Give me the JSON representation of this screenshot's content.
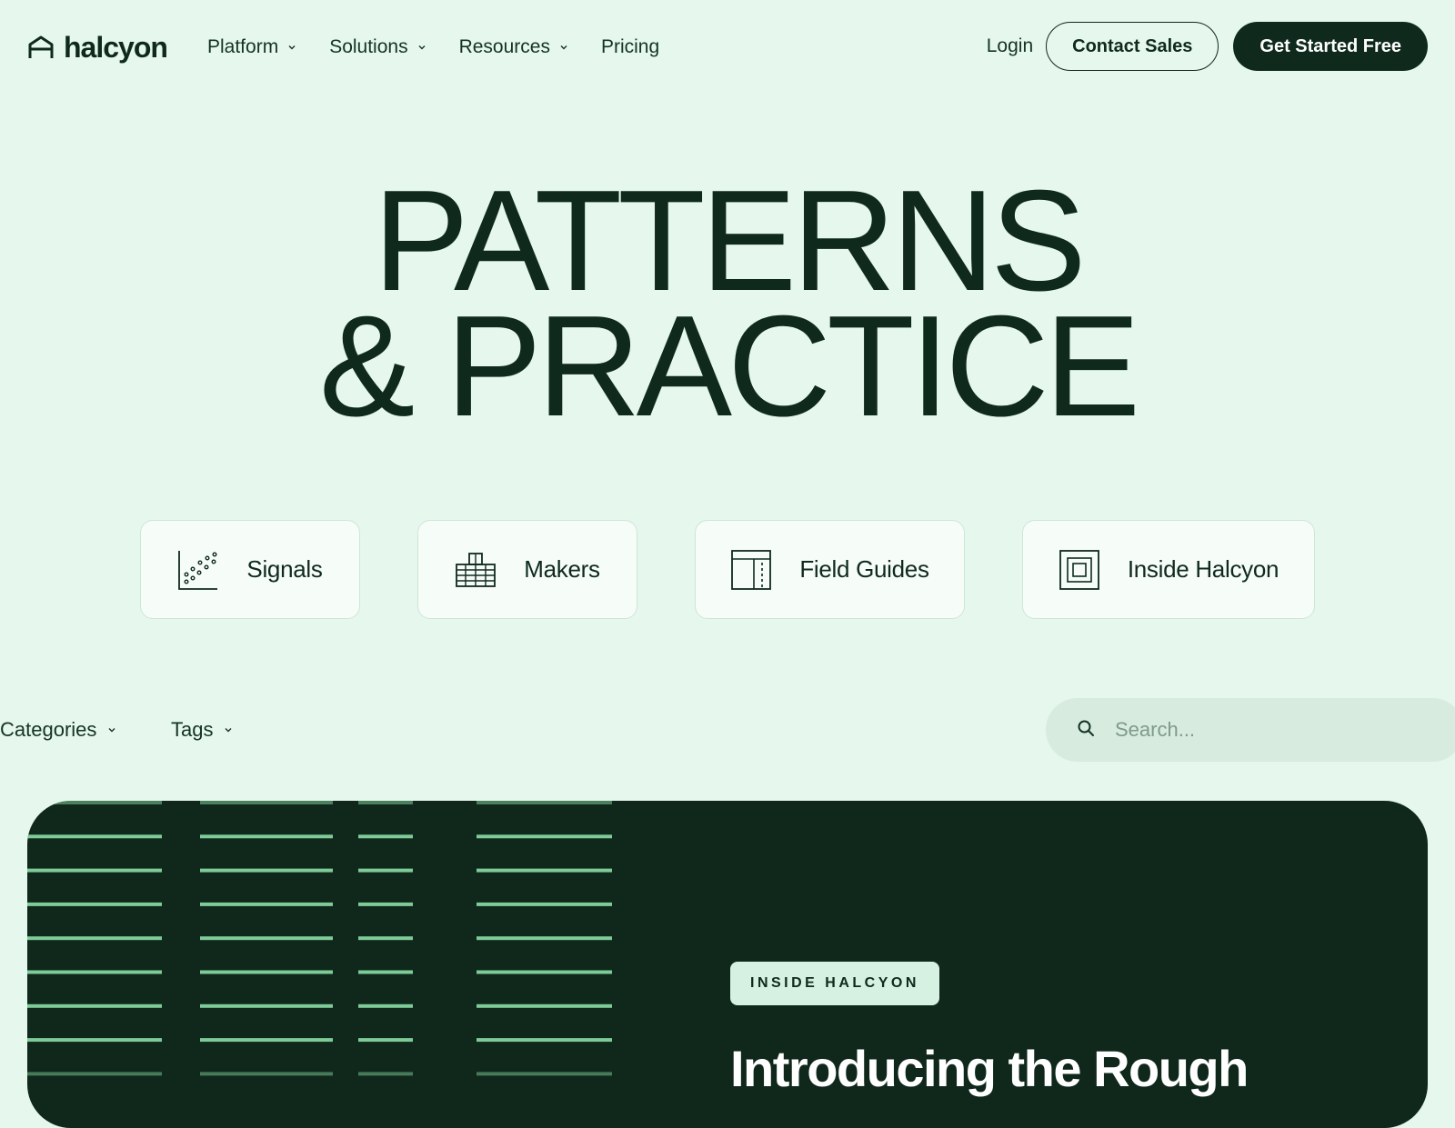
{
  "colors": {
    "background": "#e6f7ed",
    "text": "#0f2a1d",
    "feature_bg": "#0f281b",
    "stripe": "#7ecb98",
    "badge_bg": "#d6f1e1"
  },
  "brand": {
    "logo_icon": "house-outline-icon",
    "name": "halcyon"
  },
  "nav": {
    "items": [
      {
        "label": "Platform",
        "dropdown": true
      },
      {
        "label": "Solutions",
        "dropdown": true
      },
      {
        "label": "Resources",
        "dropdown": true
      },
      {
        "label": "Pricing",
        "dropdown": false
      }
    ],
    "login": "Login",
    "contact_sales": "Contact Sales",
    "get_started": "Get Started Free"
  },
  "hero": {
    "line1": "PATTERNS",
    "line2": "& PRACTICE"
  },
  "categories": [
    {
      "label": "Signals",
      "icon": "scatter-chart-icon"
    },
    {
      "label": "Makers",
      "icon": "buildings-icon"
    },
    {
      "label": "Field Guides",
      "icon": "layout-panel-icon"
    },
    {
      "label": "Inside Halcyon",
      "icon": "nested-square-icon"
    }
  ],
  "filters": {
    "categories": "Categories",
    "tags": "Tags"
  },
  "search": {
    "icon": "search-icon",
    "placeholder": "Search..."
  },
  "feature": {
    "badge": "INSIDE HALCYON",
    "title": "Introducing the Rough"
  }
}
